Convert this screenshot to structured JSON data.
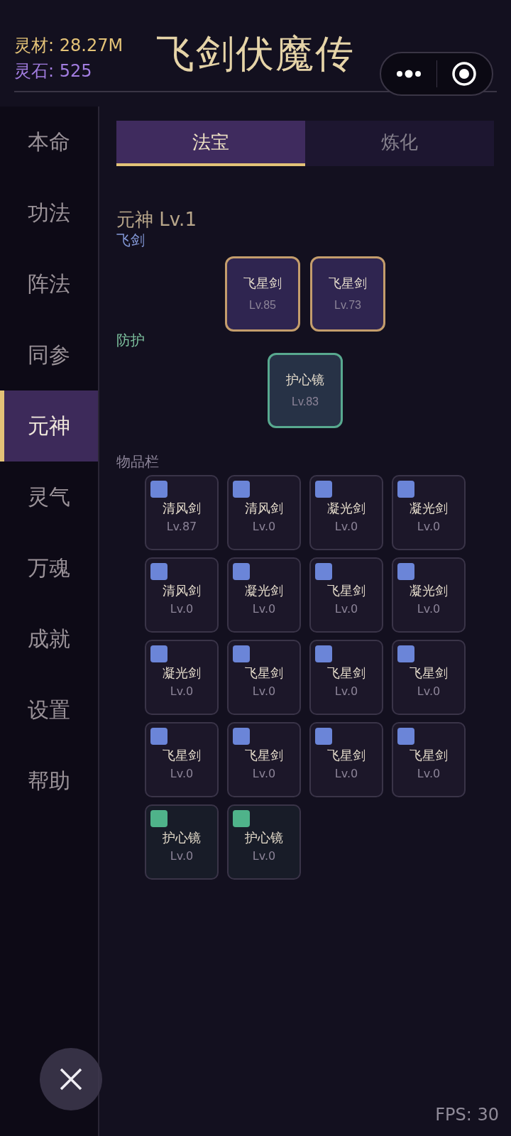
{
  "resources": [
    {
      "kind": "material",
      "text": "灵材: 28.27M"
    },
    {
      "kind": "stone",
      "text": "灵石: 525"
    }
  ],
  "title": "飞剑伏魔传",
  "sidebar": {
    "items": [
      {
        "label": "本命",
        "selected": false
      },
      {
        "label": "功法",
        "selected": false
      },
      {
        "label": "阵法",
        "selected": false
      },
      {
        "label": "同参",
        "selected": false
      },
      {
        "label": "元神",
        "selected": true
      },
      {
        "label": "灵气",
        "selected": false
      },
      {
        "label": "万魂",
        "selected": false
      },
      {
        "label": "成就",
        "selected": false
      },
      {
        "label": "设置",
        "selected": false
      },
      {
        "label": "帮助",
        "selected": false
      }
    ]
  },
  "tabs": [
    {
      "label": "法宝",
      "selected": true
    },
    {
      "label": "炼化",
      "selected": false
    }
  ],
  "heading": "元神 Lv.1",
  "equipped": [
    {
      "kind": "sword",
      "label": "飞剑",
      "items": [
        {
          "name": "飞星剑",
          "level": "Lv.85"
        },
        {
          "name": "飞星剑",
          "level": "Lv.73"
        }
      ]
    },
    {
      "kind": "armor",
      "label": "防护",
      "items": [
        {
          "name": "护心镜",
          "level": "Lv.83"
        }
      ]
    }
  ],
  "inventory": {
    "label": "物品栏",
    "items": [
      {
        "kind": "sword",
        "name": "清风剑",
        "level": "Lv.87"
      },
      {
        "kind": "sword",
        "name": "清风剑",
        "level": "Lv.0"
      },
      {
        "kind": "sword",
        "name": "凝光剑",
        "level": "Lv.0"
      },
      {
        "kind": "sword",
        "name": "凝光剑",
        "level": "Lv.0"
      },
      {
        "kind": "sword",
        "name": "清风剑",
        "level": "Lv.0"
      },
      {
        "kind": "sword",
        "name": "凝光剑",
        "level": "Lv.0"
      },
      {
        "kind": "sword",
        "name": "飞星剑",
        "level": "Lv.0"
      },
      {
        "kind": "sword",
        "name": "凝光剑",
        "level": "Lv.0"
      },
      {
        "kind": "sword",
        "name": "凝光剑",
        "level": "Lv.0"
      },
      {
        "kind": "sword",
        "name": "飞星剑",
        "level": "Lv.0"
      },
      {
        "kind": "sword",
        "name": "飞星剑",
        "level": "Lv.0"
      },
      {
        "kind": "sword",
        "name": "飞星剑",
        "level": "Lv.0"
      },
      {
        "kind": "sword",
        "name": "飞星剑",
        "level": "Lv.0"
      },
      {
        "kind": "sword",
        "name": "飞星剑",
        "level": "Lv.0"
      },
      {
        "kind": "sword",
        "name": "飞星剑",
        "level": "Lv.0"
      },
      {
        "kind": "sword",
        "name": "飞星剑",
        "level": "Lv.0"
      },
      {
        "kind": "armor",
        "name": "护心镜",
        "level": "Lv.0"
      },
      {
        "kind": "armor",
        "name": "护心镜",
        "level": "Lv.0"
      }
    ]
  },
  "fps": "FPS: 30"
}
